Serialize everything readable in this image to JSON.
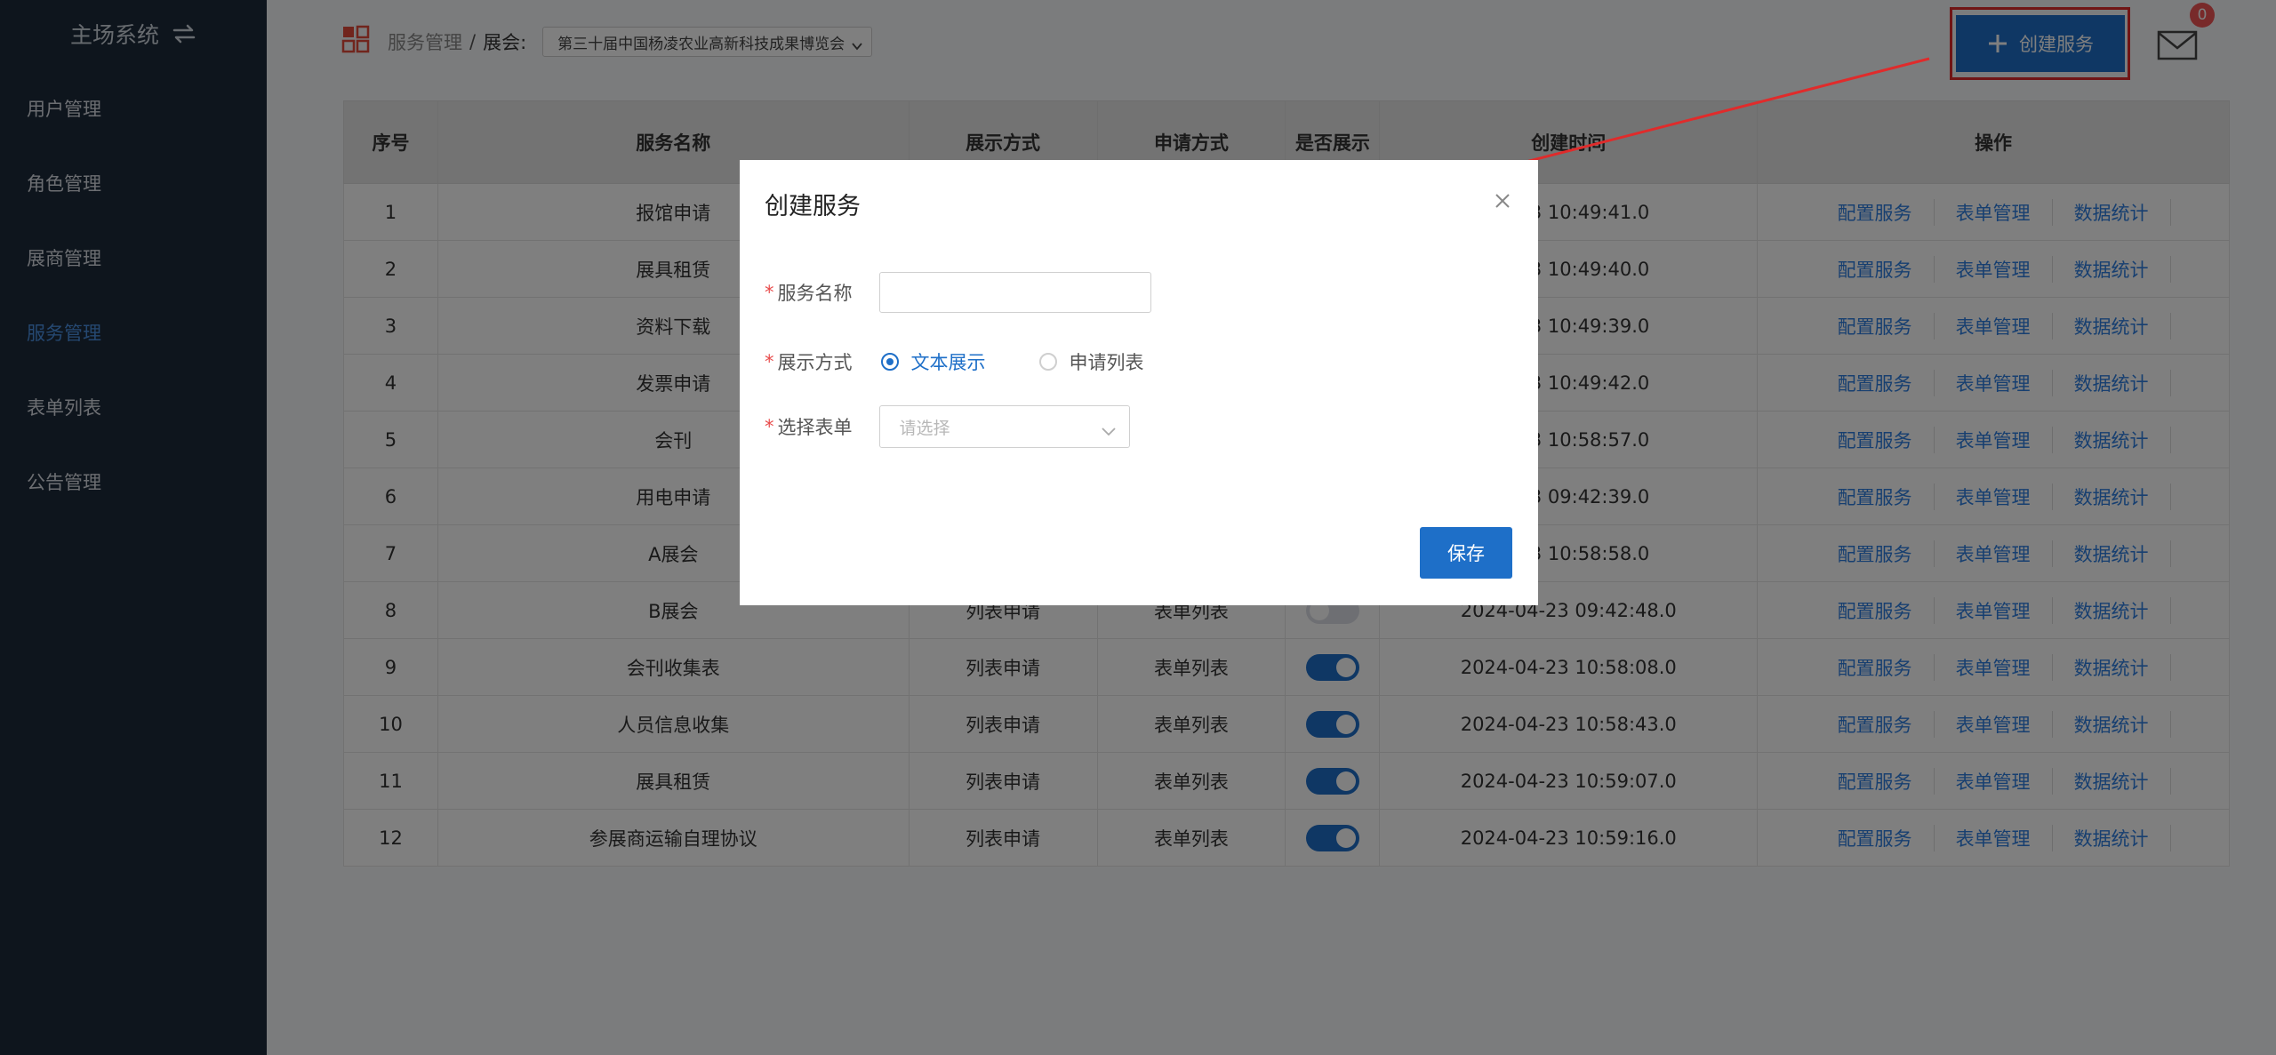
{
  "sidebar": {
    "title": "主场系统",
    "items": [
      {
        "label": "用户管理"
      },
      {
        "label": "角色管理"
      },
      {
        "label": "展商管理"
      },
      {
        "label": "服务管理",
        "active": true
      },
      {
        "label": "表单列表"
      },
      {
        "label": "公告管理"
      }
    ]
  },
  "topbar": {
    "breadcrumb_root": "服务管理",
    "breadcrumb_sep": "/",
    "expo_label": "展会:",
    "expo_selected": "第三十届中国杨凌农业高新科技成果博览会",
    "create_button": "创建服务",
    "mail_badge": "0"
  },
  "table": {
    "headers": [
      "序号",
      "服务名称",
      "展示方式",
      "申请方式",
      "是否展示",
      "创建时间",
      "操作"
    ],
    "op_labels": [
      "配置服务",
      "表单管理",
      "数据统计"
    ],
    "rows": [
      {
        "no": "1",
        "name": "报馆申请",
        "display": "",
        "apply": "",
        "shown": true,
        "time": "04-23 10:49:41.0"
      },
      {
        "no": "2",
        "name": "展具租赁",
        "display": "",
        "apply": "",
        "shown": true,
        "time": "04-23 10:49:40.0"
      },
      {
        "no": "3",
        "name": "资料下载",
        "display": "",
        "apply": "",
        "shown": true,
        "time": "04-23 10:49:39.0"
      },
      {
        "no": "4",
        "name": "发票申请",
        "display": "",
        "apply": "",
        "shown": true,
        "time": "04-23 10:49:42.0"
      },
      {
        "no": "5",
        "name": "会刊",
        "display": "",
        "apply": "",
        "shown": true,
        "time": "04-23 10:58:57.0"
      },
      {
        "no": "6",
        "name": "用电申请",
        "display": "",
        "apply": "",
        "shown": true,
        "time": "04-23 09:42:39.0"
      },
      {
        "no": "7",
        "name": "A展会",
        "display": "",
        "apply": "",
        "shown": true,
        "time": "04-23 10:58:58.0"
      },
      {
        "no": "8",
        "name": "B展会",
        "display": "列表申请",
        "apply": "表单列表",
        "shown": false,
        "time": "2024-04-23 09:42:48.0"
      },
      {
        "no": "9",
        "name": "会刊收集表",
        "display": "列表申请",
        "apply": "表单列表",
        "shown": true,
        "time": "2024-04-23 10:58:08.0"
      },
      {
        "no": "10",
        "name": "人员信息收集",
        "display": "列表申请",
        "apply": "表单列表",
        "shown": true,
        "time": "2024-04-23 10:58:43.0"
      },
      {
        "no": "11",
        "name": "展具租赁",
        "display": "列表申请",
        "apply": "表单列表",
        "shown": true,
        "time": "2024-04-23 10:59:07.0"
      },
      {
        "no": "12",
        "name": "参展商运输自理协议",
        "display": "列表申请",
        "apply": "表单列表",
        "shown": true,
        "time": "2024-04-23 10:59:16.0"
      }
    ]
  },
  "dialog": {
    "title": "创建服务",
    "required_mark": "*",
    "name_label": "服务名称",
    "name_value": "",
    "display_label": "展示方式",
    "display_option_text": "文本展示",
    "display_option_list": "申请列表",
    "form_label": "选择表单",
    "form_placeholder": "请选择",
    "save_button": "保存"
  },
  "colors": {
    "sidebar_bg": "#1d2a3a",
    "primary": "#1e6fc8",
    "link": "#2f7fe0",
    "annotation_red": "#e02b2b"
  }
}
